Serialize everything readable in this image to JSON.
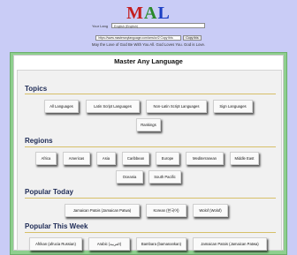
{
  "logo": {
    "m": "M",
    "a": "A",
    "l": "L"
  },
  "language_bar": {
    "label": "Your Lang",
    "selected": "English (English)"
  },
  "share": {
    "url": "https://www.masteranylanguage.com/cms/cr/2 Copy this",
    "copy_label": "Copy this"
  },
  "tagline": "May the Love of God Be With You All. God Loves You. God is Love.",
  "panel_title": "Master Any Language",
  "sections": {
    "topics": {
      "title": "Topics",
      "items": [
        "All Languages",
        "Latin Script Languages",
        "Non-Latin Script Languages",
        "Sign Languages",
        "Rankings"
      ]
    },
    "regions": {
      "title": "Regions",
      "items": [
        "Africa",
        "Americas",
        "Asia",
        "Caribbean",
        "Europe",
        "Mediterranean",
        "Middle East",
        "Oceania",
        "South Pacific"
      ]
    },
    "popular_today": {
      "title": "Popular Today",
      "items": [
        "Jamaican Patois (Jamaican Patwa)",
        "Korean (한국어)",
        "Wolof (Wolof)"
      ]
    },
    "popular_week": {
      "title": "Popular This Week",
      "items": [
        "Afrikan (afrucia Russian)",
        "Arabic (العربية)",
        "Bambara (bamanankan)",
        "Jamaican Patois (Jamaican Patwa)"
      ]
    }
  }
}
